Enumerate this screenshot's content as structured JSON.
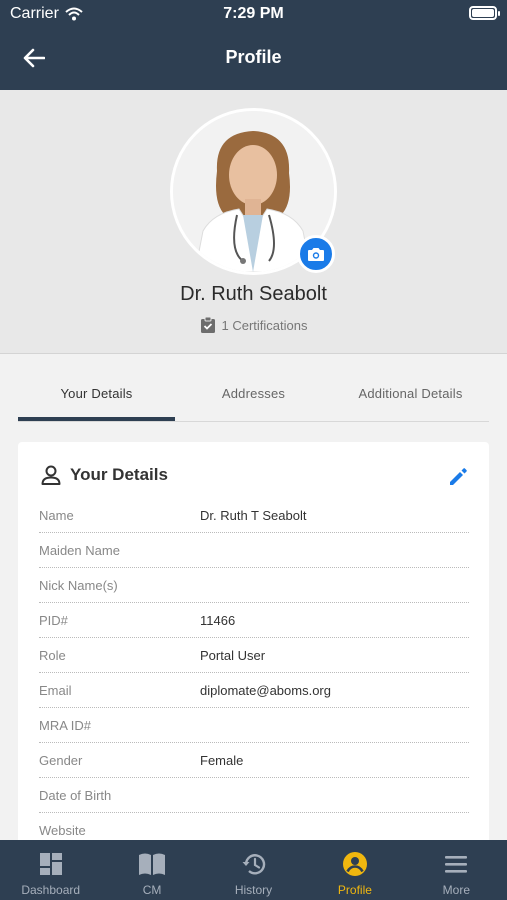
{
  "status_bar": {
    "carrier": "Carrier",
    "time": "7:29 PM"
  },
  "header": {
    "title": "Profile"
  },
  "profile": {
    "name": "Dr. Ruth Seabolt",
    "certifications": "1 Certifications"
  },
  "tabs": [
    {
      "label": "Your Details",
      "active": true
    },
    {
      "label": "Addresses"
    },
    {
      "label": "Additional Details"
    }
  ],
  "details": {
    "title": "Your Details",
    "rows": [
      {
        "label": "Name",
        "value": "Dr. Ruth T Seabolt"
      },
      {
        "label": "Maiden Name",
        "value": ""
      },
      {
        "label": "Nick Name(s)",
        "value": ""
      },
      {
        "label": "PID#",
        "value": "11466"
      },
      {
        "label": "Role",
        "value": "Portal User"
      },
      {
        "label": "Email",
        "value": "diplomate@aboms.org"
      },
      {
        "label": "MRA ID#",
        "value": ""
      },
      {
        "label": "Gender",
        "value": "Female"
      },
      {
        "label": "Date of Birth",
        "value": ""
      },
      {
        "label": "Website",
        "value": ""
      }
    ]
  },
  "tabbar": [
    {
      "label": "Dashboard",
      "icon": "dashboard-icon"
    },
    {
      "label": "CM",
      "icon": "book-icon"
    },
    {
      "label": "History",
      "icon": "history-icon"
    },
    {
      "label": "Profile",
      "icon": "profile-icon",
      "active": true
    },
    {
      "label": "More",
      "icon": "menu-icon"
    }
  ],
  "colors": {
    "header": "#2e3f52",
    "accent_blue": "#1a7be8",
    "active_tab": "#f0b70f"
  }
}
